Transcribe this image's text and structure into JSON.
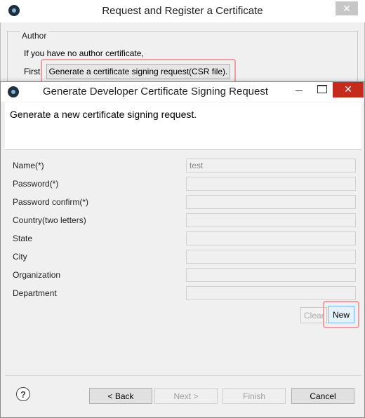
{
  "background_dialog": {
    "title": "Request and Register a Certificate",
    "close_label": "✕",
    "group_title": "Author",
    "no_cert_text": "If you have no author certificate,",
    "first_label": "First,",
    "csr_button_label": "Generate a certificate signing request(CSR file)."
  },
  "dialog": {
    "title": "Generate Developer Certificate Signing Request",
    "close_label": "✕",
    "banner_text": "Generate a new certificate signing request.",
    "fields": [
      {
        "label": "Name(*)",
        "value": "test"
      },
      {
        "label": "Password(*)",
        "value": ""
      },
      {
        "label": "Password confirm(*)",
        "value": ""
      },
      {
        "label": "Country(two letters)",
        "value": ""
      },
      {
        "label": "State",
        "value": ""
      },
      {
        "label": "City",
        "value": ""
      },
      {
        "label": "Organization",
        "value": ""
      },
      {
        "label": "Department",
        "value": ""
      }
    ],
    "clear_label": "Clear",
    "new_label": "New",
    "help_label": "?",
    "footer": {
      "back": "< Back",
      "next": "Next >",
      "finish": "Finish",
      "cancel": "Cancel"
    }
  }
}
